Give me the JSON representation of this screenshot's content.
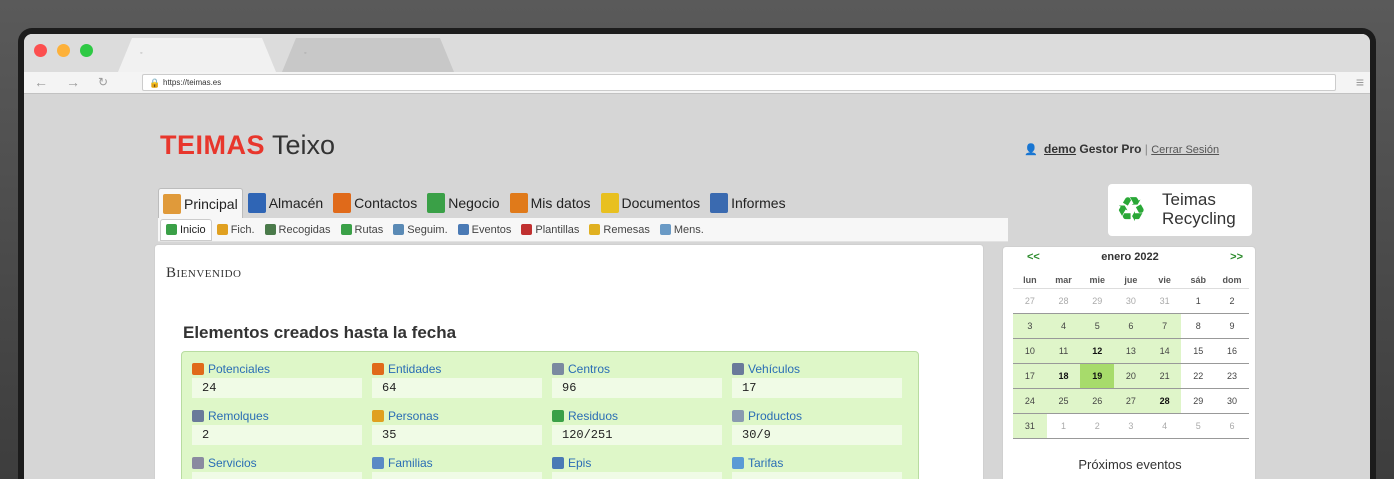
{
  "browser": {
    "url": "https://teimas.es",
    "tabs": [
      {
        "label": "◦"
      },
      {
        "label": "◦"
      }
    ]
  },
  "brand": {
    "name1": "TEIMAS",
    "name2": "Teixo"
  },
  "user": {
    "name": "demo",
    "role": "Gestor Pro",
    "separator": "|",
    "logout": "Cerrar Sesión"
  },
  "recycling_logo": {
    "line1": "Teimas",
    "line2": "Recycling"
  },
  "main_nav": [
    {
      "label": "Principal",
      "icon": "home-icon",
      "color": "#e09a3a"
    },
    {
      "label": "Almacén",
      "icon": "book-icon",
      "color": "#2f65b5"
    },
    {
      "label": "Contactos",
      "icon": "contacts-icon",
      "color": "#e06a1a"
    },
    {
      "label": "Negocio",
      "icon": "money-icon",
      "color": "#3aa047"
    },
    {
      "label": "Mis datos",
      "icon": "folder-icon",
      "color": "#e07a1a"
    },
    {
      "label": "Documentos",
      "icon": "pencil-icon",
      "color": "#e8c020"
    },
    {
      "label": "Informes",
      "icon": "printer-icon",
      "color": "#3a6ab0"
    }
  ],
  "sub_nav": [
    {
      "label": "Inicio",
      "color": "#3aa047"
    },
    {
      "label": "Fich.",
      "color": "#e0a020"
    },
    {
      "label": "Recogidas",
      "color": "#4a7a4a"
    },
    {
      "label": "Rutas",
      "color": "#3aa047"
    },
    {
      "label": "Seguim.",
      "color": "#5a8ab5"
    },
    {
      "label": "Eventos",
      "color": "#4a7ab5"
    },
    {
      "label": "Plantillas",
      "color": "#c03030"
    },
    {
      "label": "Remesas",
      "color": "#e0b020"
    },
    {
      "label": "Mens.",
      "color": "#6a9ac5"
    }
  ],
  "welcome": "Bienvenido",
  "section_title": "Elementos creados hasta la fecha",
  "stats": [
    {
      "label": "Potenciales",
      "value": "24",
      "color": "#e06a1a"
    },
    {
      "label": "Entidades",
      "value": "64",
      "color": "#e06a1a"
    },
    {
      "label": "Centros",
      "value": "96",
      "color": "#7a8aa0"
    },
    {
      "label": "Vehículos",
      "value": "17",
      "color": "#6a7a9a"
    },
    {
      "label": "Remolques",
      "value": "2",
      "color": "#6a7a9a"
    },
    {
      "label": "Personas",
      "value": "35",
      "color": "#e0a020"
    },
    {
      "label": "Residuos",
      "value": "120/251",
      "color": "#3aa047"
    },
    {
      "label": "Productos",
      "value": "30/9",
      "color": "#8a9ab0"
    },
    {
      "label": "Servicios",
      "value": "",
      "color": "#8a8aa0"
    },
    {
      "label": "Familias",
      "value": "",
      "color": "#5a8ac5"
    },
    {
      "label": "Epis",
      "value": "",
      "color": "#4a7ab5"
    },
    {
      "label": "Tarifas",
      "value": "",
      "color": "#5a9ad5"
    }
  ],
  "calendar": {
    "prev": "<<",
    "next": ">>",
    "month": "enero 2022",
    "days_of_week": [
      "lun",
      "mar",
      "mie",
      "jue",
      "vie",
      "sáb",
      "dom"
    ],
    "weeks": [
      [
        "27",
        "28",
        "29",
        "30",
        "31",
        "1",
        "2"
      ],
      [
        "3",
        "4",
        "5",
        "6",
        "7",
        "8",
        "9"
      ],
      [
        "10",
        "11",
        "12",
        "13",
        "14",
        "15",
        "16"
      ],
      [
        "17",
        "18",
        "19",
        "20",
        "21",
        "22",
        "23"
      ],
      [
        "24",
        "25",
        "26",
        "27",
        "28",
        "29",
        "30"
      ],
      [
        "31",
        "1",
        "2",
        "3",
        "4",
        "5",
        "6"
      ]
    ],
    "upcoming_title": "Próximos eventos"
  }
}
